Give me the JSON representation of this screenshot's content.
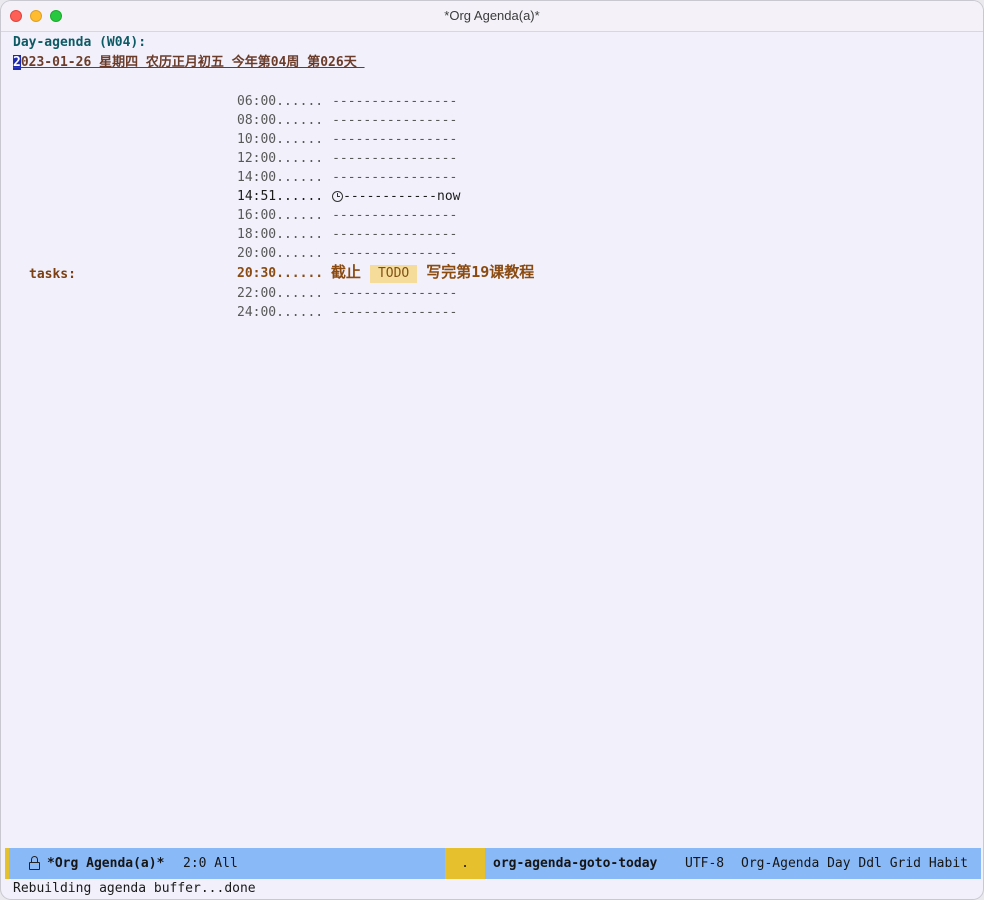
{
  "window": {
    "title": "*Org Agenda(a)*"
  },
  "agenda": {
    "header": "Day-agenda (W04):",
    "date_cursor_char": "2",
    "date_rest": "023-01-26 星期四 农历正月初五 今年第04周 第026天 ",
    "grid_dashes": "----------------",
    "grid_before": [
      {
        "time": "06:00......"
      },
      {
        "time": "08:00......"
      },
      {
        "time": "10:00......"
      },
      {
        "time": "12:00......"
      },
      {
        "time": "14:00......"
      }
    ],
    "now_line": {
      "time": "14:51......",
      "icon": "alarm-clock-icon",
      "marker": "------------now"
    },
    "grid_middle": [
      {
        "time": "16:00......"
      },
      {
        "time": "18:00......"
      },
      {
        "time": "20:00......"
      }
    ],
    "task": {
      "category": "tasks:",
      "time": "20:30......",
      "deadline_label": "截止",
      "keyword": "TODO",
      "title": "写完第19课教程"
    },
    "grid_after": [
      {
        "time": "22:00......"
      },
      {
        "time": "24:00......"
      }
    ]
  },
  "modeline": {
    "lock_icon": "lock-icon",
    "buffer_name": "*Org Agenda(a)*",
    "position": "2:0 All",
    "indicator": ".",
    "command": "org-agenda-goto-today",
    "encoding": "UTF-8",
    "modes": "Org-Agenda Day Ddl Grid Habit"
  },
  "echo_area": {
    "message": "Rebuilding agenda buffer...done"
  },
  "colors": {
    "header": "#0e5a64",
    "date": "#6b3c2a",
    "task": "#8a4a10",
    "todo_bg": "#f6dc9a",
    "modeline_bg": "#8ab9f8",
    "modeline_accent": "#e7c12d",
    "cursor": "#1e2ab0"
  }
}
